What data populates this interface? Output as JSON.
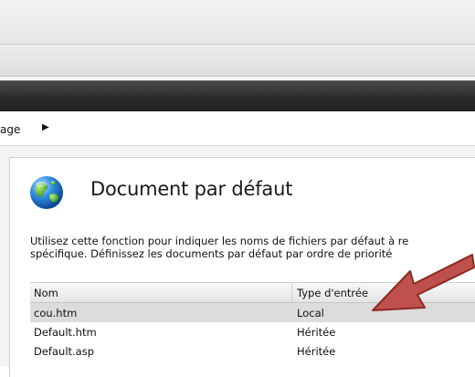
{
  "breadcrumb": {
    "text": "age"
  },
  "feature": {
    "title": "Document par défaut",
    "description_line1": "Utilisez cette fonction pour indiquer les noms de fichiers par défaut à re",
    "description_line2": "spécifique. Définissez les documents par défaut par ordre de priorité"
  },
  "table": {
    "headers": [
      "Nom",
      "Type d'entrée"
    ],
    "rows": [
      {
        "name": "cou.htm",
        "type": "Local",
        "selected": true
      },
      {
        "name": "Default.htm",
        "type": "Héritée",
        "selected": false
      },
      {
        "name": "Default.asp",
        "type": "Héritée",
        "selected": false
      }
    ]
  },
  "colors": {
    "dark_bar": "#2b2b2b",
    "selected_row": "#dcdcdc",
    "arrow_fill": "#c0504d",
    "arrow_stroke": "#8b2a27"
  },
  "icons": {
    "feature_icon": "globe-icon",
    "breadcrumb_separator": "triangle-right-icon",
    "annotation": "red-arrow-annotation"
  }
}
